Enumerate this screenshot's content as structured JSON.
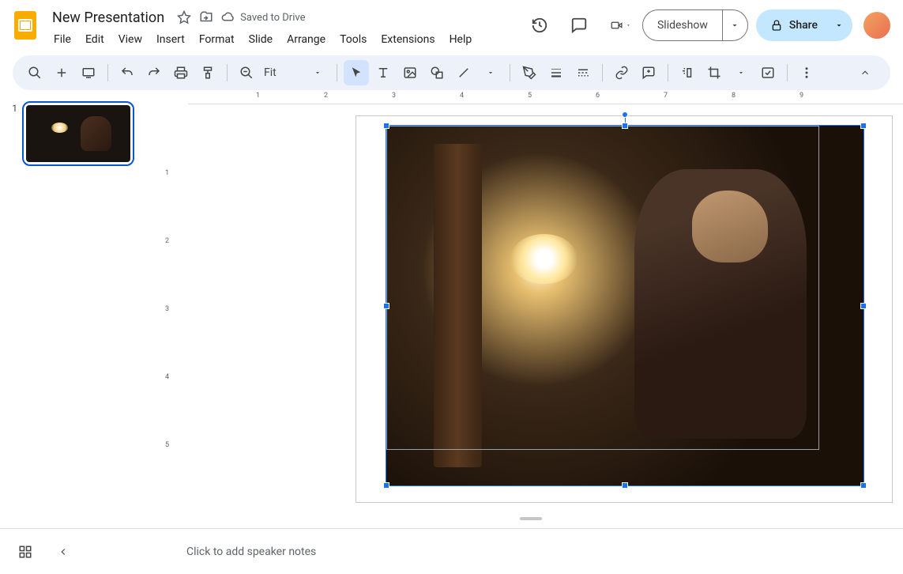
{
  "doc": {
    "title": "New Presentation",
    "save_status": "Saved to Drive"
  },
  "menus": [
    "File",
    "Edit",
    "View",
    "Insert",
    "Format",
    "Slide",
    "Arrange",
    "Tools",
    "Extensions",
    "Help"
  ],
  "header": {
    "slideshow": "Slideshow",
    "share": "Share"
  },
  "toolbar": {
    "zoom_label": "Fit"
  },
  "ruler_h": [
    "1",
    "2",
    "3",
    "4",
    "5",
    "6",
    "7",
    "8",
    "9"
  ],
  "ruler_v": [
    "1",
    "2",
    "3",
    "4",
    "5"
  ],
  "filmstrip": {
    "slides": [
      {
        "num": "1"
      }
    ]
  },
  "notes": {
    "placeholder": "Click to add speaker notes"
  }
}
